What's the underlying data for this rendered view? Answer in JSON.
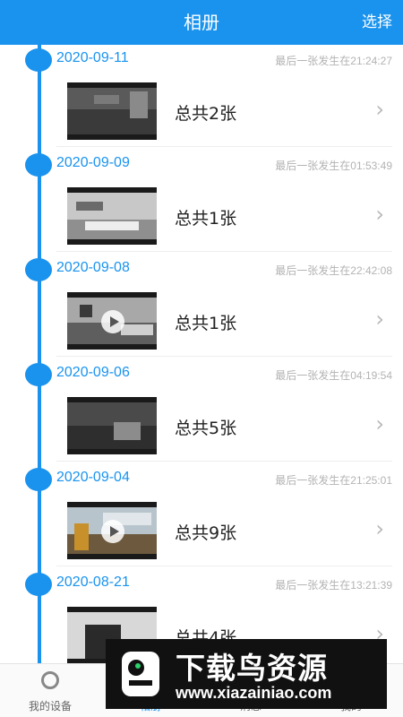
{
  "header": {
    "title": "相册",
    "select_label": "选择"
  },
  "groups": [
    {
      "date": "2020-09-11",
      "last_time": "最后一张发生在21:24:27",
      "count": "总共2张",
      "thumb_icon": "camera-snapshot"
    },
    {
      "date": "2020-09-09",
      "last_time": "最后一张发生在01:53:49",
      "count": "总共1张",
      "thumb_icon": "camera-snapshot"
    },
    {
      "date": "2020-09-08",
      "last_time": "最后一张发生在22:42:08",
      "count": "总共1张",
      "thumb_icon": "video-play"
    },
    {
      "date": "2020-09-06",
      "last_time": "最后一张发生在04:19:54",
      "count": "总共5张",
      "thumb_icon": "camera-snapshot"
    },
    {
      "date": "2020-09-04",
      "last_time": "最后一张发生在21:25:01",
      "count": "总共9张",
      "thumb_icon": "video-play"
    },
    {
      "date": "2020-08-21",
      "last_time": "最后一张发生在13:21:39",
      "count": "总共4张",
      "thumb_icon": "camera-snapshot"
    }
  ],
  "tabs": [
    {
      "label": "我的设备",
      "icon": "camera-icon"
    },
    {
      "label": "相册",
      "icon": "album-icon"
    },
    {
      "label": "消息",
      "icon": "message-icon"
    },
    {
      "label": "我的",
      "icon": "user-icon"
    }
  ],
  "watermark": {
    "title": "下载鸟资源",
    "url": "www.xiazainiao.com"
  },
  "colors": {
    "accent": "#1a93ee",
    "muted_text": "#b3b3b3"
  }
}
